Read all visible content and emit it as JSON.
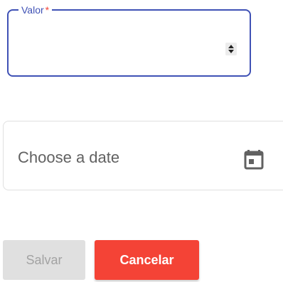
{
  "form": {
    "valor": {
      "label": "Valor",
      "required_mark": "*",
      "value": "",
      "accent_color": "#3f51b5"
    },
    "date": {
      "value": "",
      "placeholder": "Choose a date"
    }
  },
  "actions": {
    "save_label": "Salvar",
    "save_disabled": true,
    "cancel_label": "Cancelar",
    "cancel_color": "#f44336"
  },
  "icons": {
    "spinner": "number-spinner-icon",
    "calendar": "calendar-icon"
  }
}
